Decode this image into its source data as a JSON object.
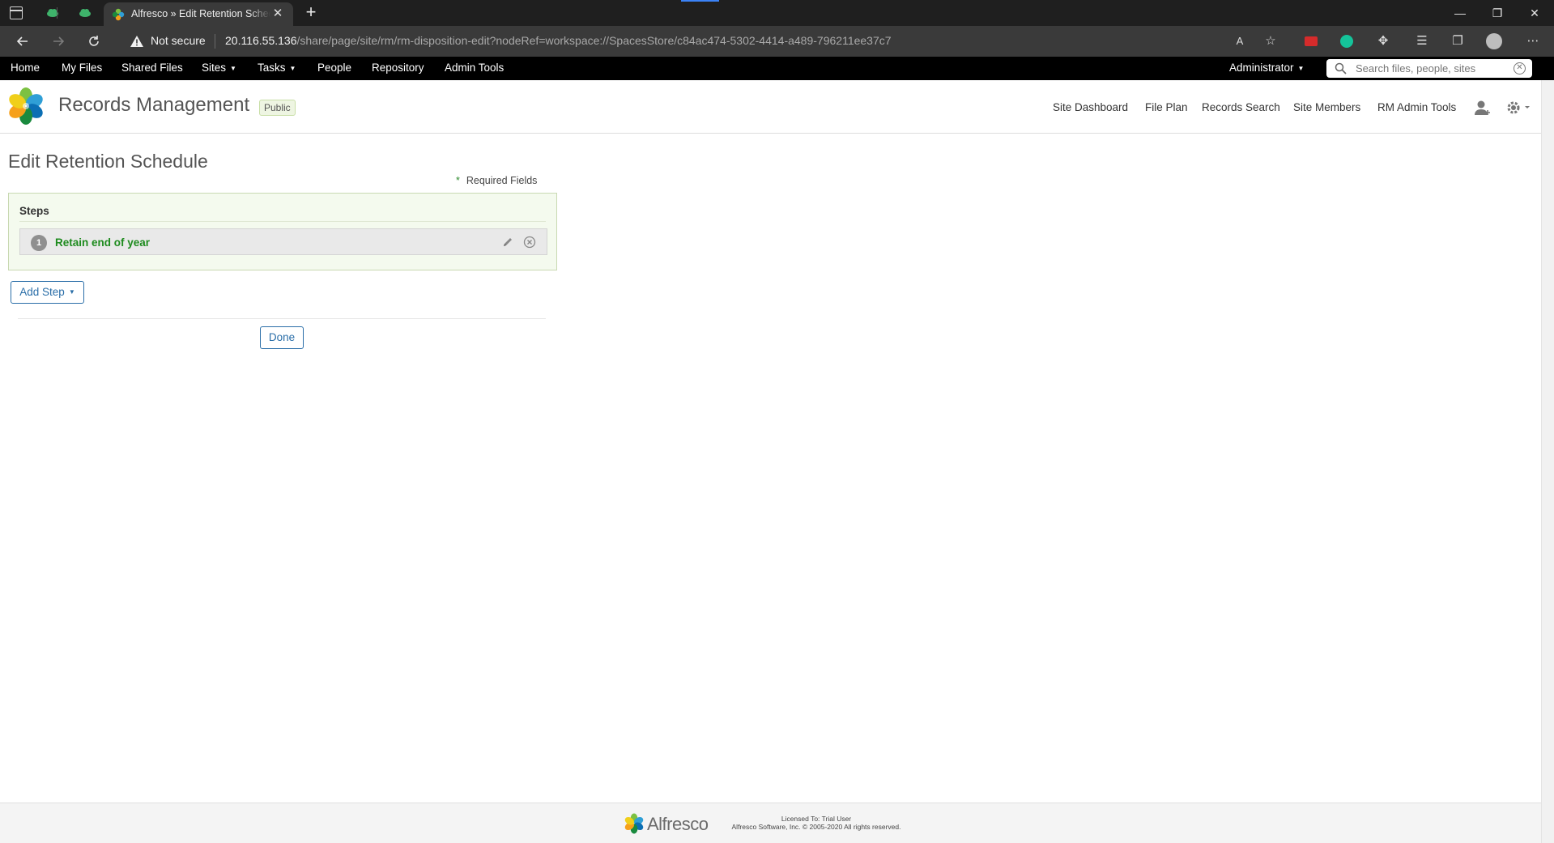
{
  "browser": {
    "tab_title": "Alfresco » Edit Retention Schedule",
    "tab_close": "✕",
    "new_tab": "+",
    "not_secure": "Not secure",
    "url_host": "20.116.55.136",
    "url_path": "/share/page/site/rm/rm-disposition-edit?nodeRef=workspace://SpacesStore/c84ac474-5302-4414-a489-796211ee37c7",
    "window_buttons": {
      "minimize": "—",
      "restore": "❐",
      "close": "✕"
    }
  },
  "app_nav": {
    "items": [
      {
        "label": "Home"
      },
      {
        "label": "My Files"
      },
      {
        "label": "Shared Files"
      },
      {
        "label": "Sites",
        "dropdown": true
      },
      {
        "label": "Tasks",
        "dropdown": true
      },
      {
        "label": "People"
      },
      {
        "label": "Repository"
      },
      {
        "label": "Admin Tools"
      }
    ],
    "user_menu": "Administrator",
    "search_placeholder": "Search files, people, sites"
  },
  "site_header": {
    "title": "Records Management",
    "visibility_badge": "Public",
    "links": [
      {
        "label": "Site Dashboard"
      },
      {
        "label": "File Plan"
      },
      {
        "label": "Records Search"
      },
      {
        "label": "Site Members"
      },
      {
        "label": "RM Admin Tools"
      }
    ]
  },
  "page": {
    "title": "Edit Retention Schedule",
    "required_star": "*",
    "required_label": "Required Fields",
    "steps_heading": "Steps",
    "steps": [
      {
        "number": "1",
        "label": "Retain end of year"
      }
    ],
    "add_step_label": "Add Step",
    "done_label": "Done"
  },
  "footer": {
    "brand": "Alfresco",
    "licensed_to": "Licensed To: Trial User",
    "copyright": "Alfresco Software, Inc. © 2005-2020 All rights reserved."
  },
  "colors": {
    "app_nav_bg": "#000000",
    "step_label": "#1e8b1e",
    "button_accent": "#2a6ea8",
    "steps_panel_bg": "#f4faee"
  }
}
